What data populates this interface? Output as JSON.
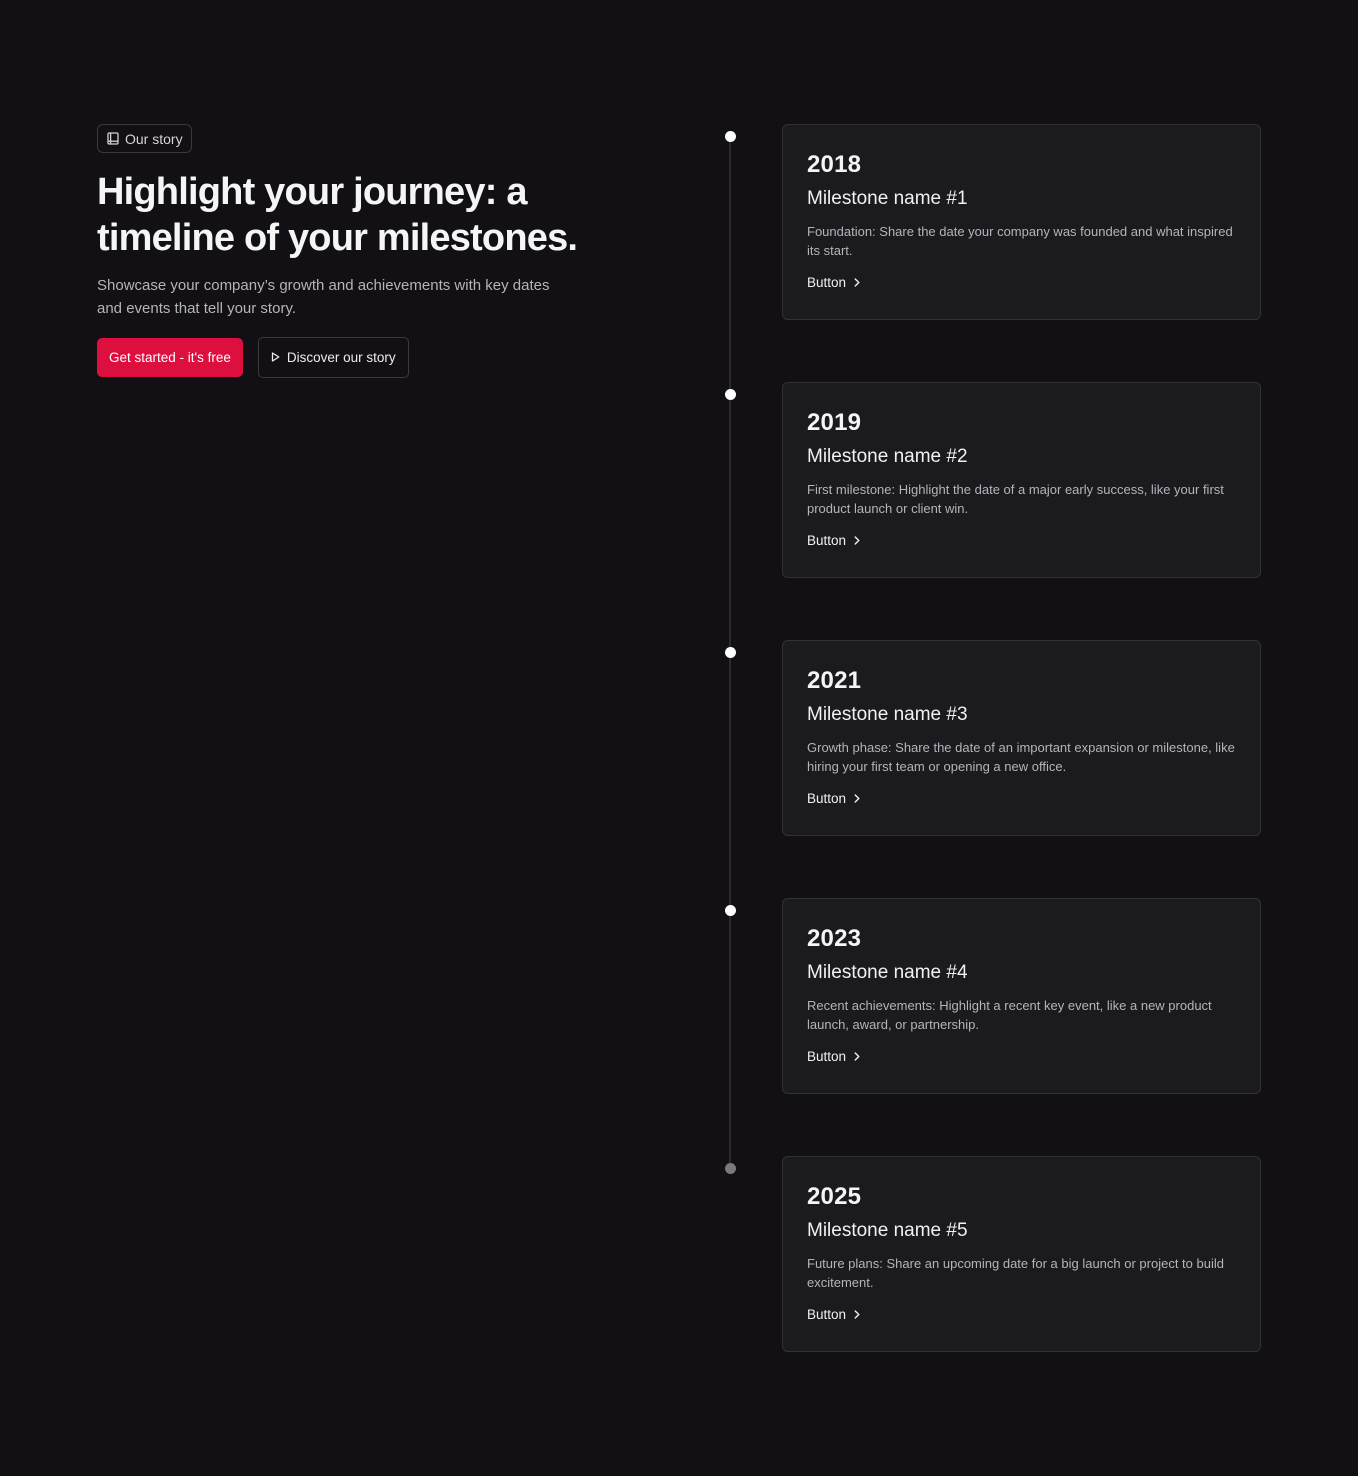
{
  "hero": {
    "badge_label": "Our story",
    "badge_icon": "book-icon",
    "headline": "Highlight your journey: a timeline of your milestones.",
    "subtext": "Showcase your company’s growth and achievements with key dates and events that tell your story.",
    "primary_button": "Get started - it's free",
    "secondary_button": "Discover our story",
    "secondary_button_icon": "play-icon"
  },
  "colors": {
    "background": "#121014",
    "card_background": "#1b1a1e",
    "accent": "#dc0f3f",
    "text": "#f4f4f5",
    "muted_text": "#b4b4b9"
  },
  "milestones": [
    {
      "year": "2018",
      "name": "Milestone name #1",
      "description": "Foundation: Share the date your company was founded and what inspired its start.",
      "button": "Button",
      "icon": "chevron-right-icon"
    },
    {
      "year": "2019",
      "name": "Milestone name #2",
      "description": "First milestone: Highlight the date of a major early success, like your first product launch or client win.",
      "button": "Button",
      "icon": "chevron-right-icon"
    },
    {
      "year": "2021",
      "name": "Milestone name #3",
      "description": "Growth phase: Share the date of an important expansion or milestone, like hiring your first team or opening a new office.",
      "button": "Button",
      "icon": "chevron-right-icon"
    },
    {
      "year": "2023",
      "name": "Milestone name #4",
      "description": "Recent achievements: Highlight a recent key event, like a new product launch, award, or partnership.",
      "button": "Button",
      "icon": "chevron-right-icon"
    },
    {
      "year": "2025",
      "name": "Milestone name #5",
      "description": "Future plans: Share an upcoming date for a big launch or project to build excitement.",
      "button": "Button",
      "icon": "chevron-right-icon"
    }
  ]
}
